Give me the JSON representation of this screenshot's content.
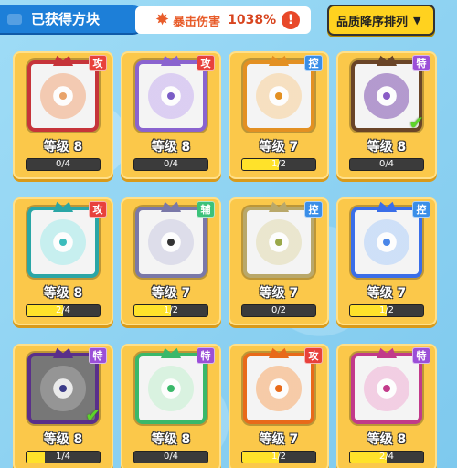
{
  "header": {
    "title": "已获得方块",
    "crit_label": "暴击伤害",
    "crit_value": "1038%",
    "info": "!",
    "sort_label": "品质降序排列",
    "sort_arrow": "▼"
  },
  "colors": {
    "attack_badge": "#e8413c",
    "control_badge": "#3a8ee8",
    "special_badge": "#9b4fd8",
    "assist_badge": "#3cc27a",
    "card_bg": "#fbc84a",
    "bar_fill": "#ffe22a"
  },
  "cards": [
    {
      "badge": "攻",
      "badge_type": "attack",
      "level": "等级 8",
      "progress": "0/4",
      "fill": 0,
      "frame": "#c6343a",
      "light": "#f3c3a6",
      "dot": "#e8a36a",
      "icon": "sun-compass-icon"
    },
    {
      "badge": "攻",
      "badge_type": "attack",
      "level": "等级 8",
      "progress": "0/4",
      "fill": 0,
      "frame": "#8a63cf",
      "light": "#d7c8f2",
      "dot": "#7a5cc6",
      "icon": "gear-ring-icon"
    },
    {
      "badge": "控",
      "badge_type": "control",
      "level": "等级 7",
      "progress": "1/2",
      "fill": 0.5,
      "frame": "#e39022",
      "light": "#f7ddb8",
      "dot": "#e39022",
      "icon": "orb-icon"
    },
    {
      "badge": "特",
      "badge_type": "special",
      "level": "等级 8",
      "progress": "0/4",
      "fill": 0,
      "frame": "#6a4528",
      "light": "#a88ac8",
      "dot": "#8a5cc6",
      "icon": "infinity-icon",
      "checked": true
    },
    {
      "badge": "攻",
      "badge_type": "attack",
      "level": "等级 8",
      "progress": "2/4",
      "fill": 0.5,
      "frame": "#2aa6a6",
      "light": "#bfeeee",
      "dot": "#3cbcbc",
      "icon": "trident-icon"
    },
    {
      "badge": "辅",
      "badge_type": "assist",
      "level": "等级 7",
      "progress": "1/2",
      "fill": 0.5,
      "frame": "#7a78a8",
      "light": "#d9d9e8",
      "dot": "#333333",
      "icon": "halo-icon"
    },
    {
      "badge": "控",
      "badge_type": "control",
      "level": "等级 7",
      "progress": "0/2",
      "fill": 0,
      "frame": "#b9a86a",
      "light": "#e8e4c8",
      "dot": "#9aa84a",
      "icon": "shield-icon"
    },
    {
      "badge": "控",
      "badge_type": "control",
      "level": "等级 7",
      "progress": "1/2",
      "fill": 0.5,
      "frame": "#3a6ee8",
      "light": "#c8dcf8",
      "dot": "#4a86e8",
      "icon": "snowflake-icon"
    },
    {
      "badge": "特",
      "badge_type": "special",
      "level": "等级 8",
      "progress": "1/4",
      "fill": 0.25,
      "frame": "#5a2f8a",
      "light": "#9a9a9a",
      "dot": "#3a3a88",
      "icon": "dark-orb-icon",
      "checked": true,
      "dim": true
    },
    {
      "badge": "特",
      "badge_type": "special",
      "level": "等级 8",
      "progress": "0/4",
      "fill": 0,
      "frame": "#3ab86a",
      "light": "#d4f2dc",
      "dot": "#3ab86a",
      "icon": "shuriken-icon"
    },
    {
      "badge": "攻",
      "badge_type": "attack",
      "level": "等级 7",
      "progress": "1/2",
      "fill": 0.5,
      "frame": "#e86a1a",
      "light": "#f7c49a",
      "dot": "#e86a1a",
      "icon": "sawblade-icon"
    },
    {
      "badge": "特",
      "badge_type": "special",
      "level": "等级 8",
      "progress": "2/4",
      "fill": 0.5,
      "frame": "#c23a8a",
      "light": "#f2c8e0",
      "dot": "#c23a8a",
      "icon": "sword-icon"
    }
  ]
}
